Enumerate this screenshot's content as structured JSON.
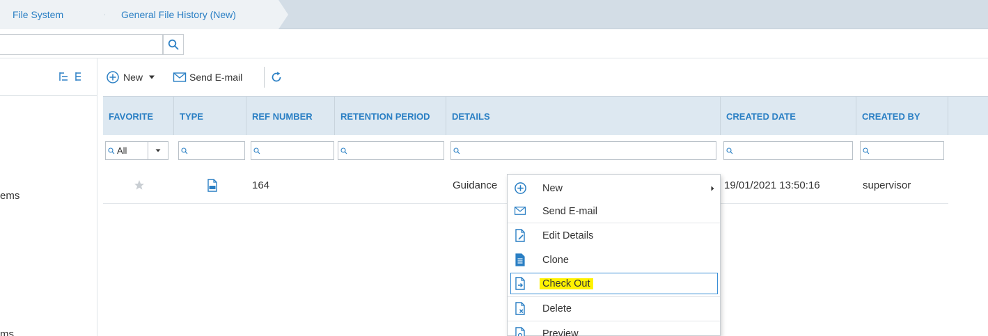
{
  "breadcrumb": {
    "items": [
      "File System",
      "General File History (New)"
    ]
  },
  "search": {
    "value": "",
    "placeholder": ""
  },
  "left_panel": {
    "partial_text_1": "ems",
    "partial_text_2": "ms"
  },
  "toolbar": {
    "new_label": "New",
    "send_email_label": "Send E-mail"
  },
  "grid": {
    "columns": [
      "FAVORITE",
      "TYPE",
      "REF NUMBER",
      "RETENTION PERIOD",
      "DETAILS",
      "CREATED DATE",
      "CREATED BY"
    ],
    "filter": {
      "favorite_value": "All"
    },
    "rows": [
      {
        "favorite": "",
        "type_icon": "pdf-icon",
        "ref_number": "164",
        "retention_period": "",
        "details": "Guidance",
        "created_date": "19/01/2021 13:50:16",
        "created_by": "supervisor"
      }
    ]
  },
  "context_menu": {
    "items": [
      {
        "label": "New",
        "icon": "plus-circle-icon",
        "has_submenu": true
      },
      {
        "label": "Send E-mail",
        "icon": "envelope-icon"
      },
      {
        "label": "Edit Details",
        "icon": "edit-document-icon"
      },
      {
        "label": "Clone",
        "icon": "clone-document-icon"
      },
      {
        "label": "Check Out",
        "icon": "checkout-document-icon",
        "highlighted": true
      },
      {
        "label": "Delete",
        "icon": "delete-document-icon"
      },
      {
        "label": "Preview",
        "icon": "preview-document-icon"
      }
    ]
  },
  "colors": {
    "accent": "#2a7fc4",
    "header_bg": "#dde8f1",
    "highlight": "#fff200"
  }
}
